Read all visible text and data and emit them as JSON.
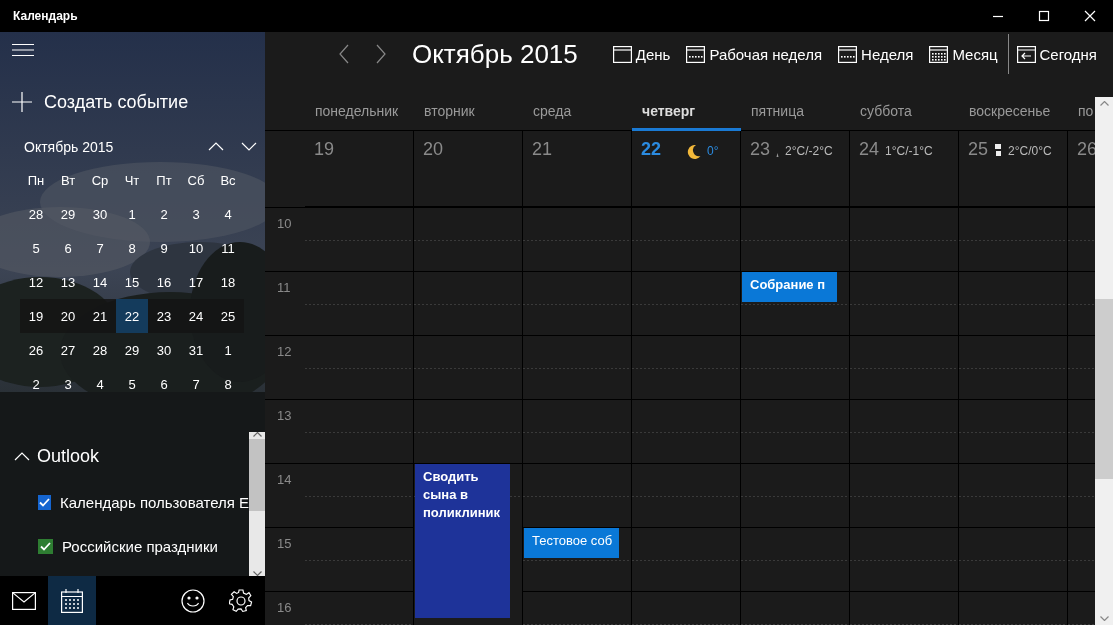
{
  "window": {
    "title": "Календарь"
  },
  "sidebar": {
    "create_event": "Создать событие",
    "mini_calendar": {
      "title": "Октябрь 2015",
      "weekdays": [
        "Пн",
        "Вт",
        "Ср",
        "Чт",
        "Пт",
        "Сб",
        "Вс"
      ],
      "weeks": [
        {
          "selected": false,
          "days": [
            {
              "label": "28",
              "selected": false
            },
            {
              "label": "29",
              "selected": false
            },
            {
              "label": "30",
              "selected": false
            },
            {
              "label": "1",
              "selected": false
            },
            {
              "label": "2",
              "selected": false
            },
            {
              "label": "3",
              "selected": false
            },
            {
              "label": "4",
              "selected": false
            }
          ]
        },
        {
          "selected": false,
          "days": [
            {
              "label": "5",
              "selected": false
            },
            {
              "label": "6",
              "selected": false
            },
            {
              "label": "7",
              "selected": false
            },
            {
              "label": "8",
              "selected": false
            },
            {
              "label": "9",
              "selected": false
            },
            {
              "label": "10",
              "selected": false
            },
            {
              "label": "11",
              "selected": false
            }
          ]
        },
        {
          "selected": false,
          "days": [
            {
              "label": "12",
              "selected": false
            },
            {
              "label": "13",
              "selected": false
            },
            {
              "label": "14",
              "selected": false
            },
            {
              "label": "15",
              "selected": false
            },
            {
              "label": "16",
              "selected": false
            },
            {
              "label": "17",
              "selected": false
            },
            {
              "label": "18",
              "selected": false
            }
          ]
        },
        {
          "selected": true,
          "days": [
            {
              "label": "19",
              "selected": false
            },
            {
              "label": "20",
              "selected": false
            },
            {
              "label": "21",
              "selected": false
            },
            {
              "label": "22",
              "selected": true
            },
            {
              "label": "23",
              "selected": false
            },
            {
              "label": "24",
              "selected": false
            },
            {
              "label": "25",
              "selected": false
            }
          ]
        },
        {
          "selected": false,
          "days": [
            {
              "label": "26",
              "selected": false
            },
            {
              "label": "27",
              "selected": false
            },
            {
              "label": "28",
              "selected": false
            },
            {
              "label": "29",
              "selected": false
            },
            {
              "label": "30",
              "selected": false
            },
            {
              "label": "31",
              "selected": false
            },
            {
              "label": "1",
              "selected": false
            }
          ]
        },
        {
          "selected": false,
          "days": [
            {
              "label": "2",
              "selected": false
            },
            {
              "label": "3",
              "selected": false
            },
            {
              "label": "4",
              "selected": false
            },
            {
              "label": "5",
              "selected": false
            },
            {
              "label": "6",
              "selected": false
            },
            {
              "label": "7",
              "selected": false
            },
            {
              "label": "8",
              "selected": false
            }
          ]
        }
      ]
    },
    "account": {
      "name": "Outlook",
      "expanded": true
    },
    "calendars": [
      {
        "label": "Календарь пользователя Е",
        "checked": true,
        "color": "#1565d0"
      },
      {
        "label": "Российские праздники",
        "checked": true,
        "color": "#2e7d32"
      }
    ],
    "nav": [
      {
        "kind": "mail",
        "selected": false
      },
      {
        "kind": "calendar",
        "selected": true
      },
      {
        "kind": "feedback",
        "selected": false
      },
      {
        "kind": "settings",
        "selected": false
      }
    ]
  },
  "toolbar": {
    "title": "Октябрь 2015",
    "views": [
      {
        "kind": "day",
        "label": "День"
      },
      {
        "kind": "workweek",
        "label": "Рабочая неделя"
      },
      {
        "kind": "week",
        "label": "Неделя"
      },
      {
        "kind": "month",
        "label": "Месяц"
      },
      {
        "kind": "today",
        "label": "Сегодня"
      }
    ]
  },
  "days": [
    {
      "name": "понедельник",
      "number": "19",
      "selected": false
    },
    {
      "name": "вторник",
      "number": "20",
      "selected": false
    },
    {
      "name": "среда",
      "number": "21",
      "selected": false
    },
    {
      "name": "четверг",
      "number": "22",
      "selected": true,
      "weather": {
        "kind": "moon",
        "reading": "0°"
      }
    },
    {
      "name": "пятница",
      "number": "23",
      "selected": false,
      "weather": {
        "kind": "rain",
        "reading": "2°C/-2°C"
      }
    },
    {
      "name": "суббота",
      "number": "24",
      "selected": false,
      "weather": {
        "kind": "none",
        "reading": "1°C/-1°C"
      }
    },
    {
      "name": "воскресенье",
      "number": "25",
      "selected": false,
      "weather": {
        "kind": "cloudy",
        "reading": "2°C/0°C"
      }
    },
    {
      "name": "по",
      "number": "26",
      "selected": false
    }
  ],
  "rows": [
    {
      "hour": "10",
      "cells": [
        {
          "kind": "empty"
        },
        {
          "kind": "empty"
        },
        {
          "kind": "empty"
        },
        {
          "kind": "empty"
        },
        {
          "kind": "empty"
        },
        {
          "kind": "empty"
        },
        {
          "kind": "empty"
        },
        {
          "kind": "empty"
        }
      ]
    },
    {
      "hour": "11",
      "cells": [
        {
          "kind": "empty"
        },
        {
          "kind": "empty"
        },
        {
          "kind": "empty"
        },
        {
          "kind": "empty"
        },
        {
          "kind": "short",
          "title": "Собрание п",
          "color": "#0a78d7"
        },
        {
          "kind": "empty"
        },
        {
          "kind": "empty"
        },
        {
          "kind": "empty"
        }
      ]
    },
    {
      "hour": "12",
      "cells": [
        {
          "kind": "empty"
        },
        {
          "kind": "empty"
        },
        {
          "kind": "empty"
        },
        {
          "kind": "empty"
        },
        {
          "kind": "empty"
        },
        {
          "kind": "empty"
        },
        {
          "kind": "empty"
        },
        {
          "kind": "empty"
        }
      ]
    },
    {
      "hour": "13",
      "cells": [
        {
          "kind": "empty"
        },
        {
          "kind": "empty"
        },
        {
          "kind": "empty"
        },
        {
          "kind": "empty"
        },
        {
          "kind": "empty"
        },
        {
          "kind": "empty"
        },
        {
          "kind": "empty"
        },
        {
          "kind": "empty"
        }
      ]
    },
    {
      "hour": "14",
      "cells": [
        {
          "kind": "empty"
        },
        {
          "kind": "long",
          "title": "Сводить сына в поликлиник",
          "color": "#1e3399"
        },
        {
          "kind": "empty"
        },
        {
          "kind": "empty"
        },
        {
          "kind": "empty"
        },
        {
          "kind": "empty"
        },
        {
          "kind": "empty"
        },
        {
          "kind": "empty"
        }
      ]
    },
    {
      "hour": "15",
      "cells": [
        {
          "kind": "empty"
        },
        {
          "kind": "covered"
        },
        {
          "kind": "short",
          "title": "Тестовое соб",
          "color": "#0a78d7"
        },
        {
          "kind": "empty"
        },
        {
          "kind": "empty"
        },
        {
          "kind": "empty"
        },
        {
          "kind": "empty"
        },
        {
          "kind": "empty"
        }
      ]
    },
    {
      "hour": "16",
      "cells": [
        {
          "kind": "empty"
        },
        {
          "kind": "covered"
        },
        {
          "kind": "empty"
        },
        {
          "kind": "empty"
        },
        {
          "kind": "empty"
        },
        {
          "kind": "empty"
        },
        {
          "kind": "empty"
        },
        {
          "kind": "empty"
        }
      ]
    }
  ]
}
